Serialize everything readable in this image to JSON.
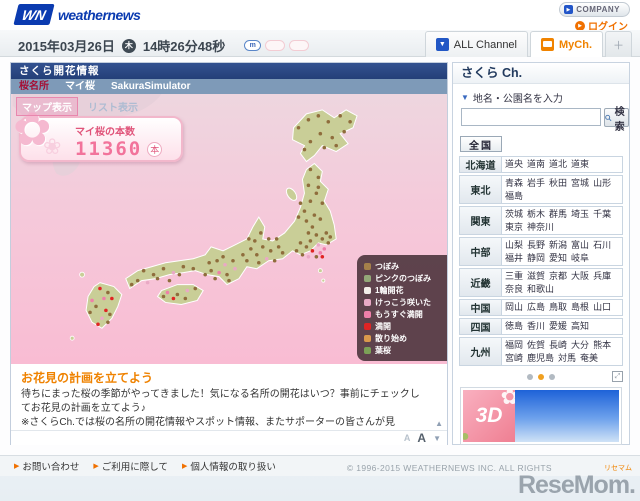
{
  "icons": {
    "caret_down": "▼",
    "arrow_up": "▲",
    "arrow_down": "▼",
    "play": "▶",
    "plus": "＋",
    "expand": "⤢"
  },
  "header": {
    "logo_mark": "WN",
    "logo": "weathernews",
    "company": "COMPANY",
    "login": "ログイン"
  },
  "datebar": {
    "date": "2015年03月26日",
    "weekday": "木",
    "time": "14時26分48秒",
    "badges": [
      "m",
      "",
      ""
    ],
    "all_channel": "ALL Channel",
    "my_channel": "MyCh.",
    "add_tab": "＋"
  },
  "panel": {
    "title": "さくら開花情報",
    "tabs": [
      {
        "label": "桜名所",
        "active": true
      },
      {
        "label": "マイ桜",
        "active": false
      },
      {
        "label": "SakuraSimulator",
        "active": false
      }
    ],
    "view_tabs": [
      {
        "label": "マップ表示",
        "active": true
      },
      {
        "label": "リスト表示",
        "active": false
      }
    ],
    "counter": {
      "label": "マイ桜の本数",
      "value": "11360",
      "unit": "本"
    },
    "legend": [
      {
        "label": "つぼみ",
        "color": "#a5804a"
      },
      {
        "label": "ピンクのつぼみ",
        "color": "#93a878"
      },
      {
        "label": "1輪開花",
        "color": "#f3eee9"
      },
      {
        "label": "けっこう咲いた",
        "color": "#e9a9c5"
      },
      {
        "label": "もうすぐ満開",
        "color": "#ef7fa9"
      },
      {
        "label": "満開",
        "color": "#e02424"
      },
      {
        "label": "散り始め",
        "color": "#d9994c"
      },
      {
        "label": "葉桜",
        "color": "#7ca157"
      }
    ],
    "article": {
      "heading": "お花見の計画を立てよう",
      "body": "待ちにまった桜の季節がやってきました！気になる名所の開花はいつ？事前にチェックしてお花見の計画を立てよう♪",
      "note": "※さくらCh.では桜の名所の開花情報やスポット情報、またサポーターの皆さんが見"
    }
  },
  "map": {
    "dot_colors": [
      "#8f6d3c",
      "#93a878",
      "#f3eee9",
      "#e9a9c5",
      "#ef7fa9",
      "#e02424",
      "#d9994c",
      "#7ca157"
    ],
    "dots": [
      [
        288,
        34,
        0
      ],
      [
        298,
        26,
        0
      ],
      [
        308,
        22,
        0
      ],
      [
        318,
        28,
        0
      ],
      [
        330,
        22,
        0
      ],
      [
        340,
        28,
        0
      ],
      [
        334,
        38,
        0
      ],
      [
        322,
        44,
        0
      ],
      [
        310,
        40,
        0
      ],
      [
        300,
        48,
        0
      ],
      [
        294,
        56,
        0
      ],
      [
        314,
        54,
        0
      ],
      [
        326,
        52,
        0
      ],
      [
        300,
        76,
        0
      ],
      [
        308,
        84,
        0
      ],
      [
        298,
        92,
        0
      ],
      [
        306,
        100,
        0
      ],
      [
        312,
        110,
        0
      ],
      [
        300,
        108,
        0
      ],
      [
        294,
        118,
        0
      ],
      [
        304,
        122,
        0
      ],
      [
        310,
        126,
        0
      ],
      [
        296,
        128,
        0
      ],
      [
        290,
        110,
        0
      ],
      [
        302,
        134,
        0
      ],
      [
        308,
        94,
        0
      ],
      [
        288,
        124,
        0
      ],
      [
        298,
        140,
        0
      ],
      [
        306,
        142,
        0
      ],
      [
        312,
        146,
        0
      ],
      [
        318,
        150,
        0
      ],
      [
        300,
        148,
        0
      ],
      [
        308,
        152,
        3
      ],
      [
        314,
        156,
        4
      ],
      [
        296,
        154,
        0
      ],
      [
        302,
        158,
        5
      ],
      [
        310,
        160,
        4
      ],
      [
        298,
        164,
        3
      ],
      [
        306,
        164,
        0
      ],
      [
        290,
        150,
        0
      ],
      [
        286,
        158,
        0
      ],
      [
        292,
        162,
        0
      ],
      [
        316,
        140,
        0
      ],
      [
        320,
        144,
        0
      ],
      [
        312,
        164,
        5
      ],
      [
        252,
        154,
        0
      ],
      [
        260,
        158,
        0
      ],
      [
        268,
        154,
        0
      ],
      [
        246,
        162,
        0
      ],
      [
        256,
        166,
        3
      ],
      [
        264,
        168,
        0
      ],
      [
        272,
        160,
        0
      ],
      [
        240,
        156,
        0
      ],
      [
        236,
        168,
        0
      ],
      [
        248,
        170,
        0
      ],
      [
        232,
        162,
        0
      ],
      [
        244,
        148,
        0
      ],
      [
        258,
        146,
        0
      ],
      [
        250,
        140,
        0
      ],
      [
        238,
        146,
        0
      ],
      [
        266,
        146,
        0
      ],
      [
        206,
        168,
        0
      ],
      [
        214,
        172,
        3
      ],
      [
        222,
        168,
        0
      ],
      [
        200,
        178,
        0
      ],
      [
        208,
        180,
        4
      ],
      [
        216,
        182,
        0
      ],
      [
        224,
        176,
        3
      ],
      [
        198,
        170,
        0
      ],
      [
        212,
        164,
        0
      ],
      [
        218,
        188,
        0
      ],
      [
        204,
        186,
        0
      ],
      [
        194,
        182,
        0
      ],
      [
        132,
        178,
        0
      ],
      [
        142,
        182,
        0
      ],
      [
        152,
        176,
        0
      ],
      [
        162,
        180,
        3
      ],
      [
        172,
        174,
        0
      ],
      [
        182,
        176,
        0
      ],
      [
        126,
        188,
        0
      ],
      [
        136,
        190,
        3
      ],
      [
        146,
        186,
        0
      ],
      [
        158,
        188,
        0
      ],
      [
        168,
        182,
        0
      ],
      [
        120,
        192,
        0
      ],
      [
        156,
        200,
        4
      ],
      [
        166,
        202,
        0
      ],
      [
        176,
        198,
        3
      ],
      [
        184,
        196,
        0
      ],
      [
        162,
        206,
        5
      ],
      [
        174,
        206,
        0
      ],
      [
        152,
        204,
        0
      ],
      [
        88,
        196,
        5
      ],
      [
        96,
        200,
        0
      ],
      [
        92,
        206,
        4
      ],
      [
        100,
        206,
        5
      ],
      [
        84,
        214,
        0
      ],
      [
        94,
        218,
        5
      ],
      [
        90,
        226,
        3
      ],
      [
        98,
        222,
        0
      ],
      [
        80,
        208,
        4
      ],
      [
        96,
        230,
        0
      ],
      [
        86,
        232,
        5
      ],
      [
        78,
        220,
        0
      ]
    ]
  },
  "sidebar": {
    "title": "さくら Ch.",
    "search_hint": "地名・公園名を入力",
    "search_button": "検索",
    "all_label": "全国",
    "regions": [
      {
        "name": "北海道",
        "prefs": [
          "道央",
          "道南",
          "道北",
          "道東"
        ]
      },
      {
        "name": "東北",
        "prefs": [
          "青森",
          "岩手",
          "秋田",
          "宮城",
          "山形",
          "福島"
        ]
      },
      {
        "name": "関東",
        "prefs": [
          "茨城",
          "栃木",
          "群馬",
          "埼玉",
          "千葉",
          "東京",
          "神奈川"
        ]
      },
      {
        "name": "中部",
        "prefs": [
          "山梨",
          "長野",
          "新潟",
          "富山",
          "石川",
          "福井",
          "静岡",
          "愛知",
          "岐阜"
        ]
      },
      {
        "name": "近畿",
        "prefs": [
          "三重",
          "滋賀",
          "京都",
          "大阪",
          "兵庫",
          "奈良",
          "和歌山"
        ]
      },
      {
        "name": "中国",
        "prefs": [
          "岡山",
          "広島",
          "鳥取",
          "島根",
          "山口"
        ]
      },
      {
        "name": "四国",
        "prefs": [
          "徳島",
          "香川",
          "愛媛",
          "高知"
        ]
      },
      {
        "name": "九州",
        "prefs": [
          "福岡",
          "佐賀",
          "長崎",
          "大分",
          "熊本",
          "宮崎",
          "鹿児島",
          "対馬",
          "奄美"
        ]
      }
    ]
  },
  "banner": {
    "label": "3D"
  },
  "footer": {
    "links": [
      "お問い合わせ",
      "ご利用に際して",
      "個人情報の取り扱い"
    ],
    "copyright": "© 1996-2015 WEATHERNEWS INC. ALL RIGHTS",
    "watermark_jp": "リセマム",
    "watermark_en": "ReseMom."
  }
}
